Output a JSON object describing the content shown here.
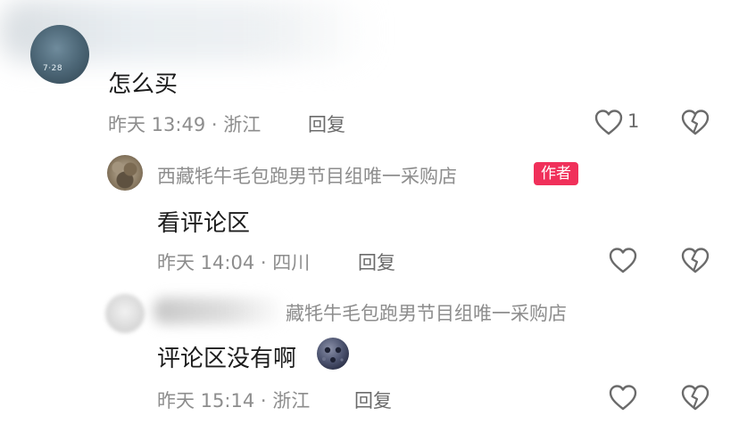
{
  "comments": [
    {
      "text": "怎么买",
      "time_location": "昨天 13:49 · 浙江",
      "reply_label": "回复",
      "like_count": "1",
      "avatar_text": "7·28"
    },
    {
      "username": "西藏牦牛毛包跑男节目组唯一采购店",
      "badge": "作者",
      "text": "看评论区",
      "time_location": "昨天 14:04 · 四川",
      "reply_label": "回复"
    },
    {
      "username_visible": "藏牦牛毛包跑男节目组唯一采购店",
      "text": "评论区没有啊",
      "time_location": "昨天 15:14 · 浙江",
      "reply_label": "回复"
    }
  ],
  "colors": {
    "badge_bg": "#f0305a",
    "meta_text": "#8d8d8d"
  },
  "icons": [
    "heart-outline-icon",
    "broken-heart-icon",
    "moon-face-emoji"
  ]
}
